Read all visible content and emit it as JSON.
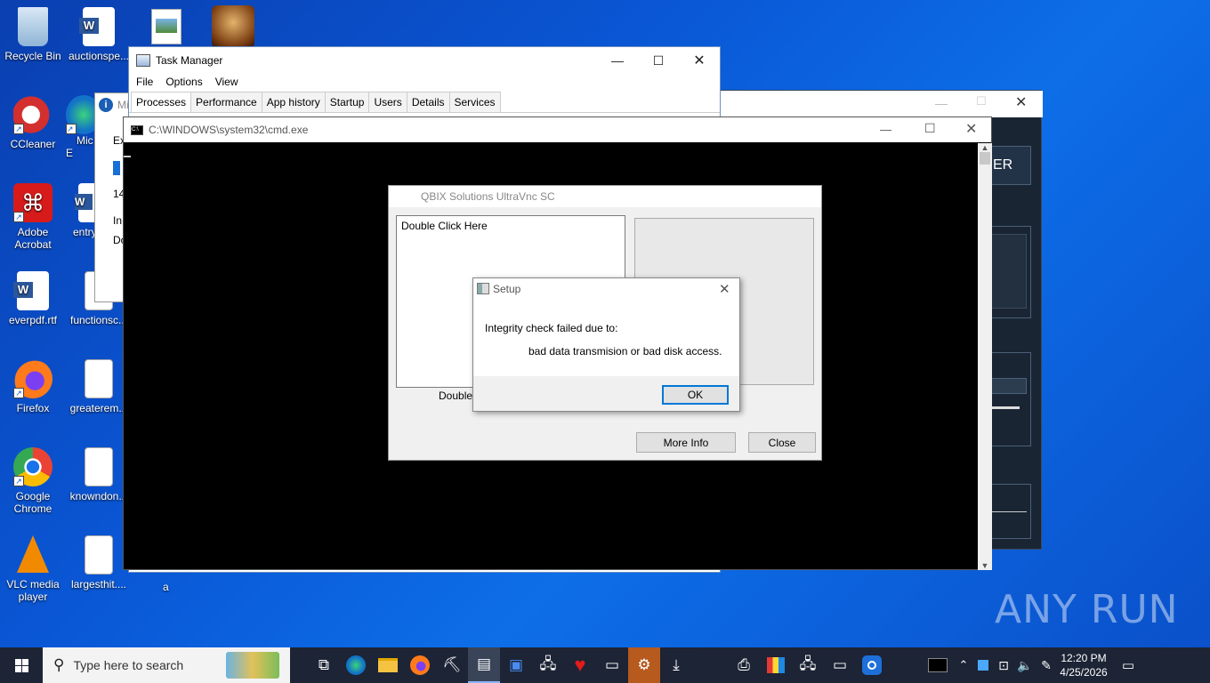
{
  "desktop": {
    "icons": [
      {
        "label": "Recycle Bin"
      },
      {
        "label": "auctionspe..."
      },
      {
        "label": "CCleaner"
      },
      {
        "label": "Mic E"
      },
      {
        "label": "Adobe Acrobat"
      },
      {
        "label": "entry"
      },
      {
        "label": "everpdf.rtf"
      },
      {
        "label": "functionsc..."
      },
      {
        "label": "Firefox"
      },
      {
        "label": "greaterem..."
      },
      {
        "label": "Google Chrome"
      },
      {
        "label": "knowndon..."
      },
      {
        "label": "VLC media player"
      },
      {
        "label": "largesthit...."
      },
      {
        "label": "a"
      }
    ]
  },
  "task_manager": {
    "title": "Task Manager",
    "menu": [
      "File",
      "Options",
      "View"
    ],
    "tabs": [
      "Processes",
      "Performance",
      "App history",
      "Startup",
      "Users",
      "Details",
      "Services"
    ]
  },
  "background_window": {
    "partial_title": "Mi",
    "partial_lines": [
      "Ex",
      "14",
      "In",
      "Do"
    ],
    "right_label": "ER"
  },
  "cmd": {
    "title": "C:\\WINDOWS\\system32\\cmd.exe"
  },
  "qbix": {
    "title": "QBIX Solutions UltraVnc SC",
    "list_item": "Double Click Here",
    "below_label": "Double C",
    "more_info_label": "More Info",
    "close_label": "Close"
  },
  "setup": {
    "title": "Setup",
    "line1": "Integrity check failed due to:",
    "line2": "bad data transmision or bad disk access.",
    "ok_label": "OK"
  },
  "taskbar": {
    "search_placeholder": "Type here to search",
    "time": "12:20 PM",
    "date": "4/25/2026"
  },
  "watermark": "ANY RUN"
}
